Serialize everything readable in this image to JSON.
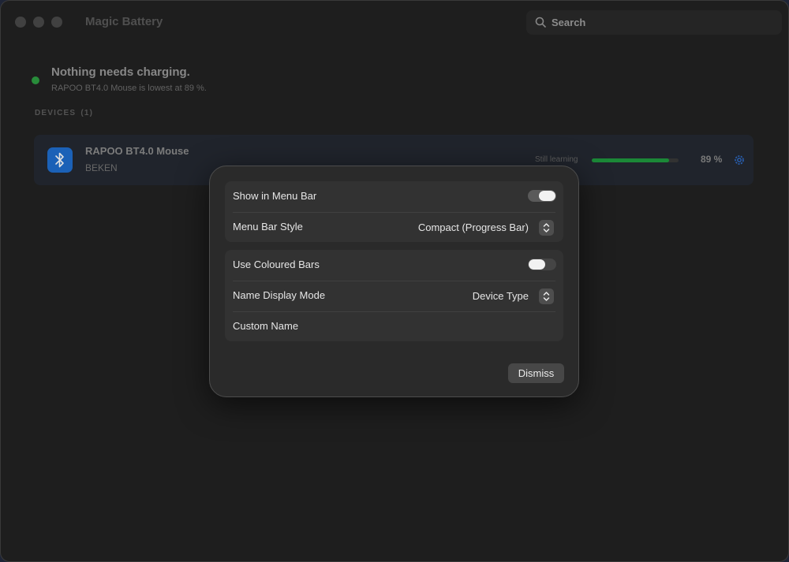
{
  "window": {
    "title": "Magic Battery"
  },
  "search": {
    "placeholder": "Search"
  },
  "status": {
    "title": "Nothing needs charging.",
    "subtitle": "RAPOO BT4.0 Mouse is lowest at 89 %.",
    "color": "#2ea043"
  },
  "devices": {
    "header": "DEVICES",
    "count": "(1)",
    "items": [
      {
        "name": "RAPOO BT4.0 Mouse",
        "vendor": "BEKEN",
        "icon": "bluetooth-icon",
        "state": "Still learning",
        "battery_fraction": 0.89,
        "battery_label": "89 %"
      }
    ]
  },
  "sheet": {
    "group1": {
      "show_in_menu_bar": {
        "label": "Show in Menu Bar",
        "on": true
      },
      "menu_bar_style": {
        "label": "Menu Bar Style",
        "value": "Compact (Progress Bar)"
      }
    },
    "group2": {
      "use_coloured_bars": {
        "label": "Use Coloured Bars",
        "on": false
      },
      "name_display_mode": {
        "label": "Name Display Mode",
        "value": "Device Type"
      },
      "custom_name": {
        "label": "Custom Name"
      }
    },
    "dismiss_label": "Dismiss"
  },
  "colors": {
    "accent_blue": "#1f6fd1",
    "battery_green": "#1f9b3f"
  }
}
